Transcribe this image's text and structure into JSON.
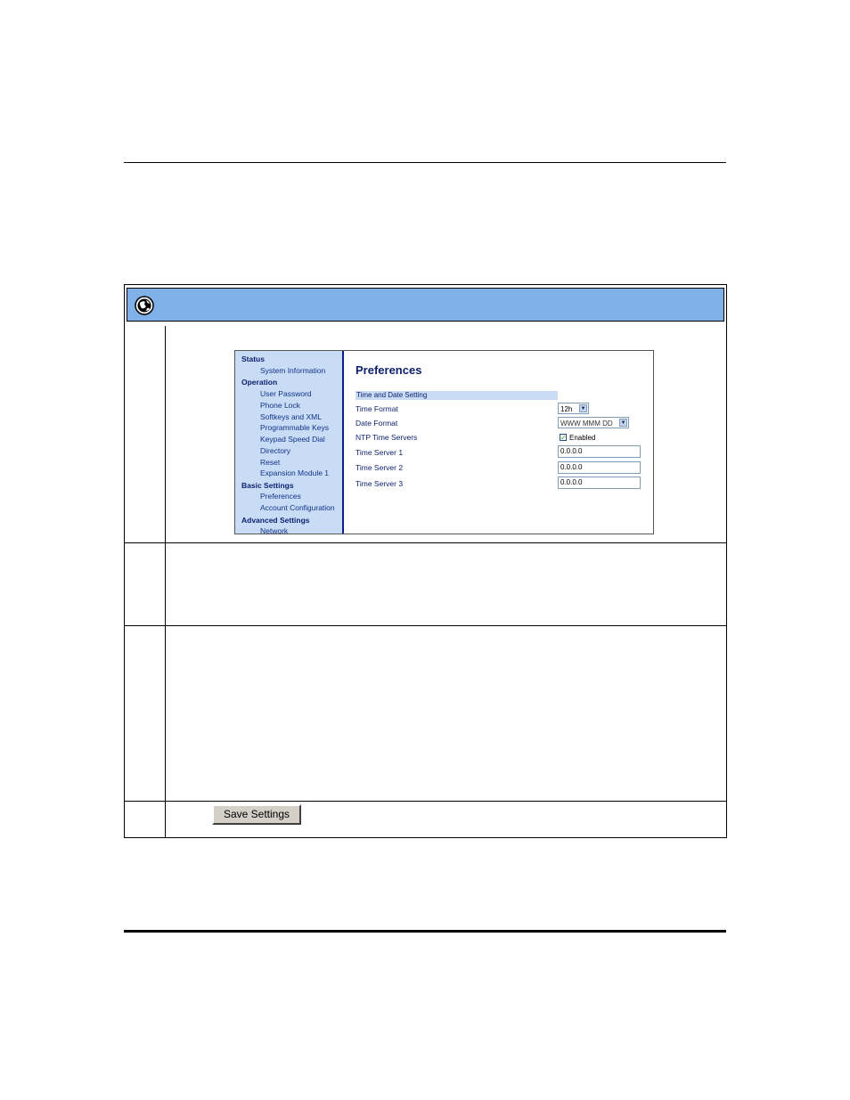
{
  "sidebar": {
    "items": [
      {
        "label": "Status",
        "type": "head"
      },
      {
        "label": "System Information",
        "type": "sub"
      },
      {
        "label": "Operation",
        "type": "head"
      },
      {
        "label": "User Password",
        "type": "sub"
      },
      {
        "label": "Phone Lock",
        "type": "sub"
      },
      {
        "label": "Softkeys and XML",
        "type": "sub"
      },
      {
        "label": "Programmable Keys",
        "type": "sub"
      },
      {
        "label": "Keypad Speed Dial",
        "type": "sub"
      },
      {
        "label": "Directory",
        "type": "sub"
      },
      {
        "label": "Reset",
        "type": "sub"
      },
      {
        "label": "Expansion Module 1",
        "type": "sub"
      },
      {
        "label": "Basic Settings",
        "type": "head"
      },
      {
        "label": "Preferences",
        "type": "sub"
      },
      {
        "label": "Account Configuration",
        "type": "sub"
      },
      {
        "label": "Advanced Settings",
        "type": "head"
      },
      {
        "label": "Network",
        "type": "sub"
      }
    ]
  },
  "main": {
    "title": "Preferences",
    "section": "Time and Date Setting",
    "time_format": {
      "label": "Time Format",
      "value": "12h"
    },
    "date_format": {
      "label": "Date Format",
      "value": "WWW MMM DD"
    },
    "ntp": {
      "label": "NTP Time Servers",
      "checkbox_label": "Enabled",
      "checked": true
    },
    "time_server_1": {
      "label": "Time Server 1",
      "value": "0.0.0.0"
    },
    "time_server_2": {
      "label": "Time Server 2",
      "value": "0.0.0.0"
    },
    "time_server_3": {
      "label": "Time Server 3",
      "value": "0.0.0.0"
    }
  },
  "save_button": {
    "label": "Save Settings"
  },
  "icons": {
    "banner": "globe-icon",
    "select_arrow": "chevron-down-icon",
    "checkbox": "checkmark-icon"
  }
}
